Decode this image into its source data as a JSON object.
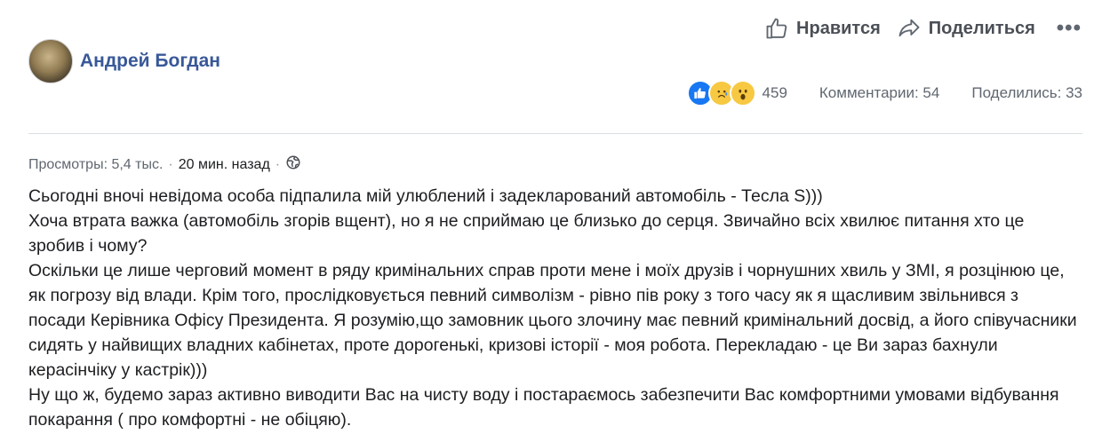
{
  "actions": {
    "like_label": "Нравится",
    "share_label": "Поделиться",
    "more_label": "•••"
  },
  "author": {
    "name": "Андрей Богдан"
  },
  "stats": {
    "reactions": [
      "like-icon",
      "sad-face-icon",
      "wow-face-icon"
    ],
    "reaction_count": "459",
    "comments": "Комментарии: 54",
    "shares": "Поделились: 33"
  },
  "meta": {
    "views": "Просмотры: 5,4 тыс.",
    "separator": "·",
    "time": "20 мин. назад",
    "privacy_icon": "globe-icon"
  },
  "post": {
    "lines": [
      "Сьогодні вночі невідома особа підпалила мій улюблений і задекларований автомобіль - Тесла S)))",
      "Хоча втрата важка (автомобіль згорів вщент), но я не сприймаю це близько до серця. Звичайно всіх хвилює питання хто це зробив і чому?",
      "Оскільки це лише черговий момент в ряду кримінальних справ проти мене і моїх друзів і чорнушних хвиль у ЗМІ, я розцінюю це, як погрозу від влади. Крім того, прослідковується певний символізм - рівно пів року з того часу як я щасливим звільнився з посади Керівника Офісу Президента. Я розумію,що замовник цього злочину має певний кримінальний досвід, а його співучасники сидять у найвищих владних кабінетах, проте дорогенькі, кризові історії - моя робота. Перекладаю - це Ви зараз бахнули керасінчіку у кастрік)))",
      "Ну що ж, будемо зараз активно виводити Вас на чисту воду і постараємось забезпечити Вас комфортними умовами відбування покарання ( про комфортні - не обіцяю)."
    ]
  },
  "colors": {
    "author_link": "#385898",
    "secondary_text": "#606770",
    "like_blue": "#1877f2",
    "emoji_yellow": "#f7c841"
  }
}
